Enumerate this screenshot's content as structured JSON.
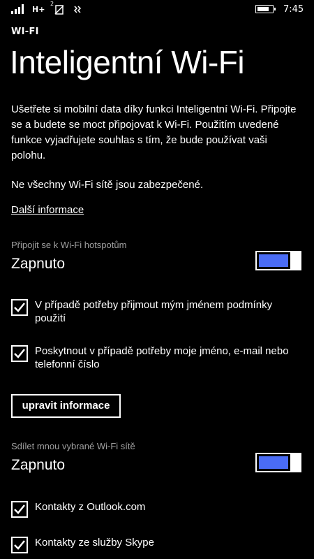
{
  "status_bar": {
    "network_type": "H+",
    "sim_number": "2",
    "time": "7:45",
    "icons": [
      "signal-icon",
      "no-sim-icon",
      "vibrate-icon",
      "battery-icon"
    ]
  },
  "header": {
    "app_title": "WI-FI",
    "page_title": "Inteligentní Wi-Fi"
  },
  "intro": {
    "paragraph1": "Ušetřete si mobilní data díky funkci Inteligentní Wi-Fi. Připojte se a budete se moct připojovat k Wi-Fi. Použitím uvedené funkce vyjadřujete souhlas s tím, že bude používat vaši polohu.",
    "paragraph2": "Ne všechny Wi-Fi sítě jsou zabezpečené.",
    "more_info_link": "Další informace"
  },
  "hotspots": {
    "label": "Připojit se k Wi-Fi hotspotům",
    "value": "Zapnuto",
    "enabled": true,
    "options": [
      {
        "label": "V případě potřeby přijmout mým jménem podmínky použití",
        "checked": true
      },
      {
        "label": "Poskytnout v případě potřeby moje jméno, e-mail nebo telefonní číslo",
        "checked": true
      }
    ],
    "edit_button": "upravit informace"
  },
  "sharing": {
    "label": "Sdílet mnou vybrané Wi-Fi sítě",
    "value": "Zapnuto",
    "enabled": true,
    "options": [
      {
        "label": "Kontakty z Outlook.com",
        "checked": true
      },
      {
        "label": "Kontakty ze služby Skype",
        "checked": true
      }
    ]
  },
  "colors": {
    "background": "#000000",
    "text": "#ffffff",
    "secondary_text": "#a0a0a0",
    "accent": "#4a6cf5"
  }
}
